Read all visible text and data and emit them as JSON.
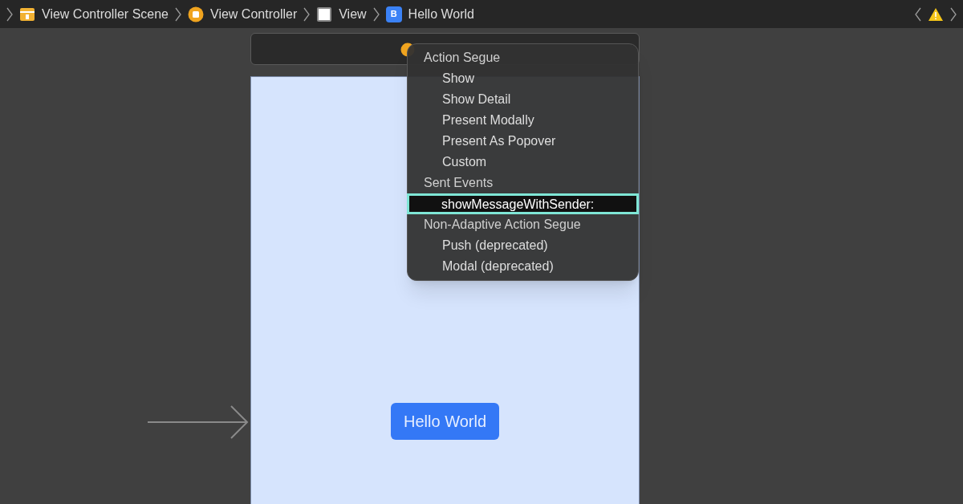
{
  "breadcrumbs": [
    {
      "kind": "scene",
      "label": "View Controller Scene"
    },
    {
      "kind": "controller",
      "label": "View Controller"
    },
    {
      "kind": "view",
      "label": "View"
    },
    {
      "kind": "button",
      "label": "Hello World",
      "badge": "B"
    }
  ],
  "menu": [
    {
      "kind": "header",
      "label": "Action Segue"
    },
    {
      "kind": "item",
      "label": "Show",
      "selected": false
    },
    {
      "kind": "item",
      "label": "Show Detail",
      "selected": false
    },
    {
      "kind": "item",
      "label": "Present Modally",
      "selected": false
    },
    {
      "kind": "item",
      "label": "Present As Popover",
      "selected": false
    },
    {
      "kind": "item",
      "label": "Custom",
      "selected": false
    },
    {
      "kind": "header",
      "label": "Sent Events"
    },
    {
      "kind": "item",
      "label": "showMessageWithSender:",
      "selected": true
    },
    {
      "kind": "header",
      "label": "Non-Adaptive Action Segue"
    },
    {
      "kind": "item",
      "label": "Push (deprecated)",
      "selected": false
    },
    {
      "kind": "item",
      "label": "Modal (deprecated)",
      "selected": false
    }
  ],
  "scene": {
    "button": "Hello World"
  }
}
